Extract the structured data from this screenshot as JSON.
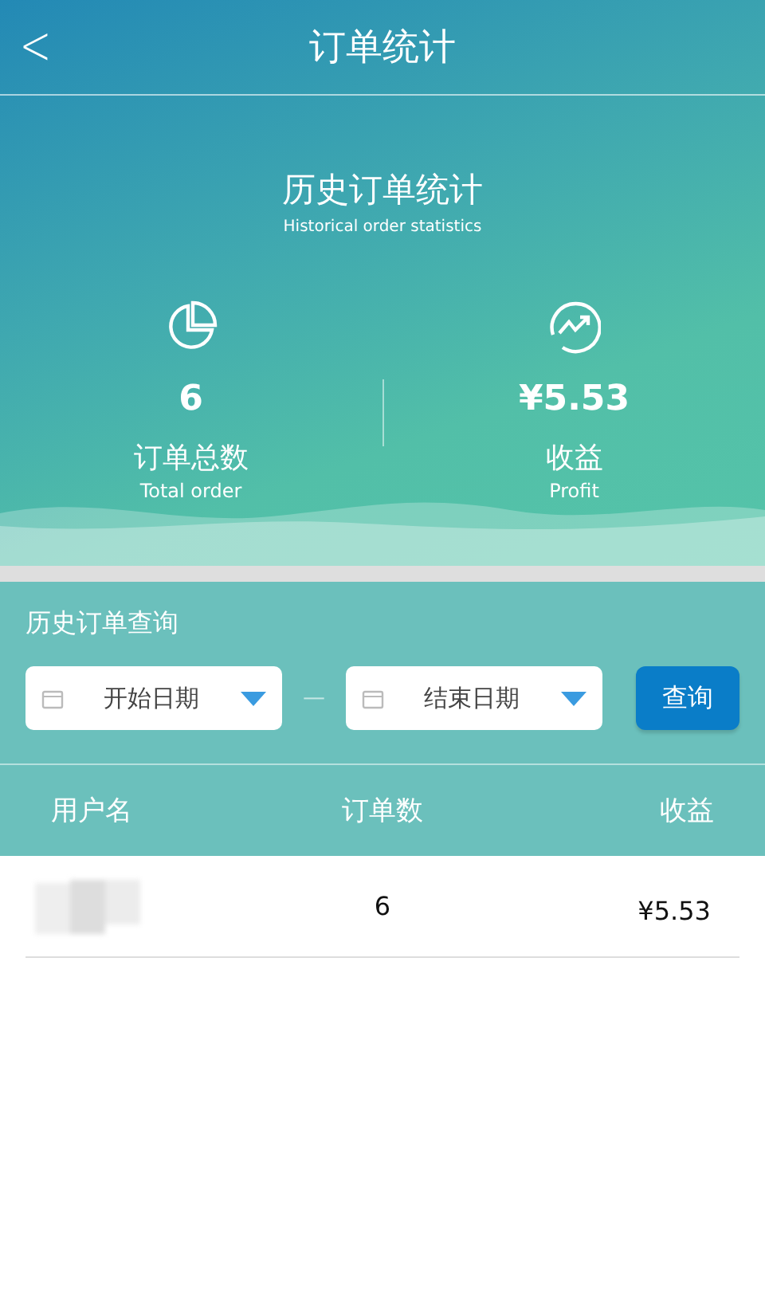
{
  "header": {
    "back": "<",
    "title": "订单统计"
  },
  "summary": {
    "title": "历史订单统计",
    "subtitle": "Historical order statistics",
    "stats": [
      {
        "kind": "orders",
        "value": "6",
        "label": "订单总数",
        "sublabel": "Total order"
      },
      {
        "kind": "profit",
        "value": "¥5.53",
        "label": "收益",
        "sublabel": "Profit"
      }
    ]
  },
  "query": {
    "title": "历史订单查询",
    "start": {
      "placeholder": "开始日期"
    },
    "separator": "—",
    "end": {
      "placeholder": "结束日期"
    },
    "button": "查询"
  },
  "table": {
    "columns": [
      "用户名",
      "订单数",
      "收益"
    ],
    "rows": [
      {
        "orders": "6",
        "profit": "¥5.53"
      }
    ]
  }
}
